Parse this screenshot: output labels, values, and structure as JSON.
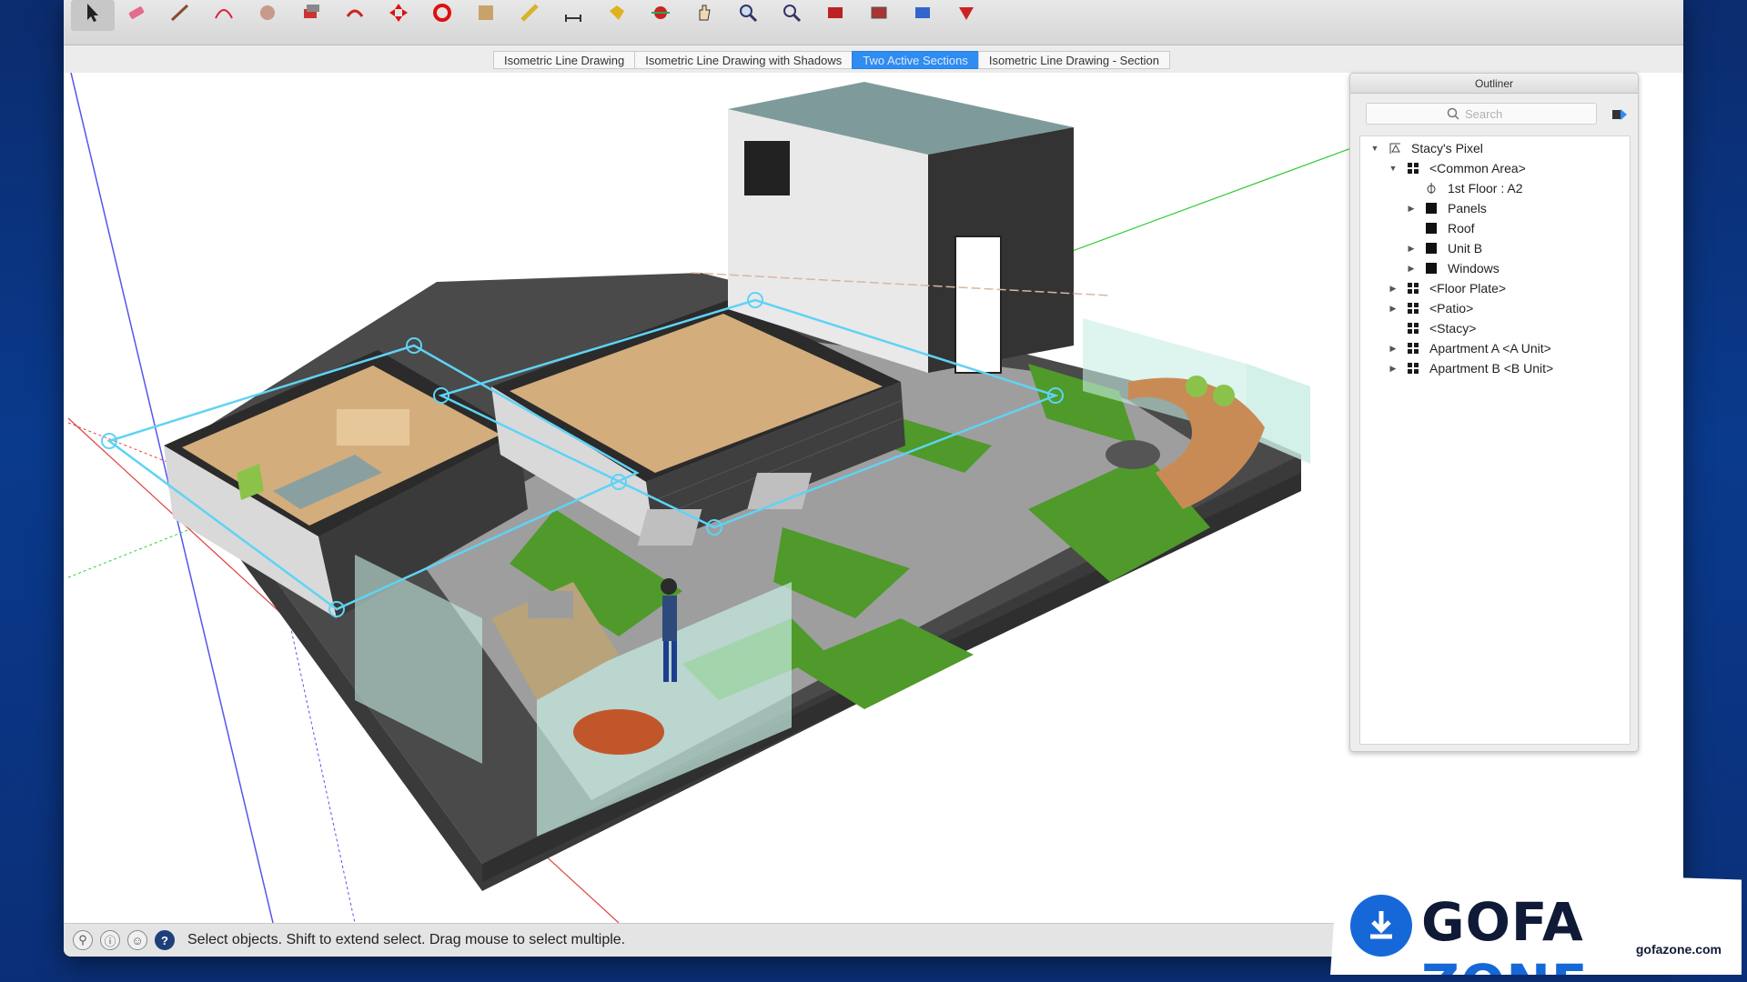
{
  "scene_tabs": [
    {
      "label": "Isometric Line Drawing",
      "active": false
    },
    {
      "label": "Isometric Line Drawing with Shadows",
      "active": false
    },
    {
      "label": "Two Active Sections",
      "active": true
    },
    {
      "label": "Isometric Line Drawing - Section",
      "active": false
    }
  ],
  "outliner": {
    "title": "Outliner",
    "search_placeholder": "Search",
    "items": [
      {
        "label": "Stacy's Pixel",
        "toggle": "▼",
        "icon": "model-icon"
      },
      {
        "label": "<Common Area>",
        "toggle": "▼",
        "icon": "component-icon"
      },
      {
        "label": "1st Floor : A2",
        "toggle": "",
        "icon": "section-plane-icon"
      },
      {
        "label": "Panels",
        "toggle": "▶",
        "icon": "group-icon"
      },
      {
        "label": "Roof",
        "toggle": "",
        "icon": "group-icon"
      },
      {
        "label": "Unit B",
        "toggle": "▶",
        "icon": "group-icon"
      },
      {
        "label": "Windows",
        "toggle": "▶",
        "icon": "group-icon"
      },
      {
        "label": "<Floor Plate>",
        "toggle": "▶",
        "icon": "component-icon"
      },
      {
        "label": "<Patio>",
        "toggle": "▶",
        "icon": "component-icon"
      },
      {
        "label": "<Stacy>",
        "toggle": "",
        "icon": "component-icon"
      },
      {
        "label": "Apartment A <A Unit>",
        "toggle": "▶",
        "icon": "component-icon"
      },
      {
        "label": "Apartment B <B Unit>",
        "toggle": "▶",
        "icon": "component-icon"
      }
    ]
  },
  "status": {
    "message": "Select objects. Shift to extend select. Drag mouse to select multiple.",
    "help_icon_glyph": "?"
  },
  "watermark": {
    "brand_primary": "GOFA",
    "brand_secondary": "ZONE",
    "url": "gofazone.com",
    "brand_color": "#1668d8"
  },
  "colors": {
    "active_tab": "#2f8cf0",
    "section_plane": "#5fd3f5",
    "grass": "#4f9a2a",
    "paving": "#9e9e9e"
  }
}
